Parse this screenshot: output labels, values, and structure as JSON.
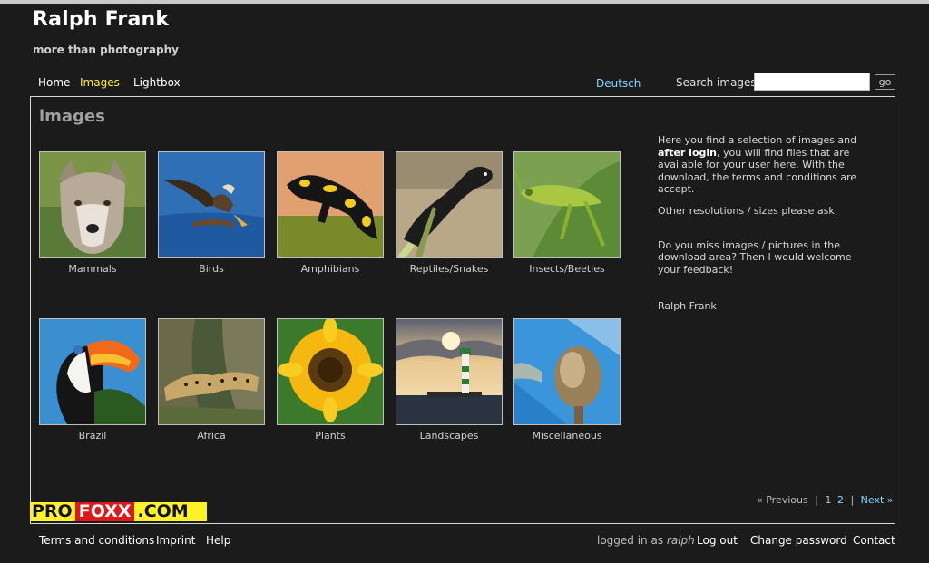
{
  "site": {
    "title": "Ralph Frank",
    "subtitle": "more than photography"
  },
  "nav": {
    "items": [
      {
        "label": "Home"
      },
      {
        "label": "Images"
      },
      {
        "label": "Lightbox"
      }
    ],
    "language": "Deutsch"
  },
  "search": {
    "label": "Search images:",
    "value": "",
    "button": "go"
  },
  "main": {
    "title": "images",
    "categories": [
      {
        "label": "Mammals"
      },
      {
        "label": "Birds"
      },
      {
        "label": "Amphibians"
      },
      {
        "label": "Reptiles/Snakes"
      },
      {
        "label": "Insects/Beetles"
      },
      {
        "label": "Brazil"
      },
      {
        "label": "Africa"
      },
      {
        "label": "Plants"
      },
      {
        "label": "Landscapes"
      },
      {
        "label": "Miscellaneous"
      }
    ]
  },
  "info": {
    "p1_before": "Here you find a selection of images and ",
    "p1_bold": "after login",
    "p1_after": ", you will find files that are available for your user here. With the download, the terms and conditions are accept.",
    "p2": "Other resolutions / sizes please ask.",
    "p3": "Do you miss images / pictures in the download area? Then I would welcome your feedback!",
    "p4": "Ralph Frank"
  },
  "pagination": {
    "previous": "« Previous",
    "separator": "|",
    "page1": "1",
    "page2": "2",
    "next": "Next »"
  },
  "logo": {
    "part1": "PRO",
    "part2": "FOXX",
    "part3": ".COM"
  },
  "footer": {
    "terms": "Terms and conditions",
    "imprint": "Imprint",
    "help": "Help",
    "logged_in_prefix": "logged in as ",
    "user": "ralph",
    "logout": "Log out",
    "change_password": "Change password",
    "contact": "Contact"
  },
  "colors": {
    "background": "#1b1b1b",
    "active_nav": "#ffef3a",
    "link": "#7fd9ff",
    "logo_yellow": "#fff12a",
    "logo_red": "#e0181b"
  }
}
